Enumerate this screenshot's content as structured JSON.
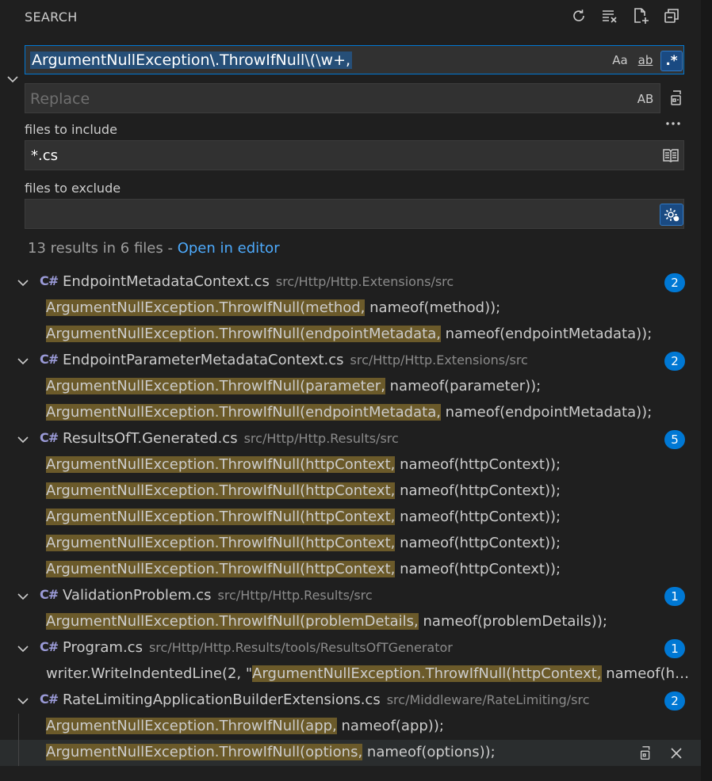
{
  "header": {
    "title": "SEARCH",
    "icons": [
      "refresh-icon",
      "clear-results-icon",
      "new-search-editor-icon",
      "collapse-all-icon"
    ]
  },
  "search": {
    "value": "ArgumentNullException\\.ThrowIfNull\\(\\w+,",
    "match_case_label": "Aa",
    "whole_word_label": "ab",
    "regex_label": ".*"
  },
  "replace": {
    "placeholder": "Replace",
    "preserve_case_label": "AB"
  },
  "include": {
    "label": "files to include",
    "value": "*.cs"
  },
  "exclude": {
    "label": "files to exclude",
    "value": ""
  },
  "summary": {
    "text": "13 results in 6 files - ",
    "link": "Open in editor"
  },
  "colors": {
    "accent": "#0078d4",
    "match_highlight": "#6b5a2a",
    "selection": "#264f78",
    "link": "#4daafc"
  },
  "files": [
    {
      "icon": "C#",
      "name": "EndpointMetadataContext.cs",
      "path": "src/Http/Http.Extensions/src",
      "count": "2",
      "matches": [
        {
          "pre": "",
          "hit": "ArgumentNullException.ThrowIfNull(method,",
          "post": " nameof(method));"
        },
        {
          "pre": "",
          "hit": "ArgumentNullException.ThrowIfNull(endpointMetadata,",
          "post": " nameof(endpointMetadata));"
        }
      ]
    },
    {
      "icon": "C#",
      "name": "EndpointParameterMetadataContext.cs",
      "path": "src/Http/Http.Extensions/src",
      "count": "2",
      "matches": [
        {
          "pre": "",
          "hit": "ArgumentNullException.ThrowIfNull(parameter,",
          "post": " nameof(parameter));"
        },
        {
          "pre": "",
          "hit": "ArgumentNullException.ThrowIfNull(endpointMetadata,",
          "post": " nameof(endpointMetadata));"
        }
      ]
    },
    {
      "icon": "C#",
      "name": "ResultsOfT.Generated.cs",
      "path": "src/Http/Http.Results/src",
      "count": "5",
      "matches": [
        {
          "pre": "",
          "hit": "ArgumentNullException.ThrowIfNull(httpContext,",
          "post": " nameof(httpContext));"
        },
        {
          "pre": "",
          "hit": "ArgumentNullException.ThrowIfNull(httpContext,",
          "post": " nameof(httpContext));"
        },
        {
          "pre": "",
          "hit": "ArgumentNullException.ThrowIfNull(httpContext,",
          "post": " nameof(httpContext));"
        },
        {
          "pre": "",
          "hit": "ArgumentNullException.ThrowIfNull(httpContext,",
          "post": " nameof(httpContext));"
        },
        {
          "pre": "",
          "hit": "ArgumentNullException.ThrowIfNull(httpContext,",
          "post": " nameof(httpContext));"
        }
      ]
    },
    {
      "icon": "C#",
      "name": "ValidationProblem.cs",
      "path": "src/Http/Http.Results/src",
      "count": "1",
      "matches": [
        {
          "pre": "",
          "hit": "ArgumentNullException.ThrowIfNull(problemDetails,",
          "post": " nameof(problemDetails));"
        }
      ]
    },
    {
      "icon": "C#",
      "name": "Program.cs",
      "path": "src/Http/Http.Results/tools/ResultsOfTGenerator",
      "count": "1",
      "matches": [
        {
          "pre": "writer.WriteIndentedLine(2, \"",
          "hit": "ArgumentNullException.ThrowIfNull(httpContext,",
          "post": " nameof(httpContext));\");"
        }
      ]
    },
    {
      "icon": "C#",
      "name": "RateLimitingApplicationBuilderExtensions.cs",
      "path": "src/Middleware/RateLimiting/src",
      "count": "2",
      "matches": [
        {
          "pre": "",
          "hit": "ArgumentNullException.ThrowIfNull(app,",
          "post": " nameof(app));"
        },
        {
          "pre": "",
          "hit": "ArgumentNullException.ThrowIfNull(options,",
          "post": " nameof(options));",
          "selected": true
        }
      ]
    }
  ]
}
